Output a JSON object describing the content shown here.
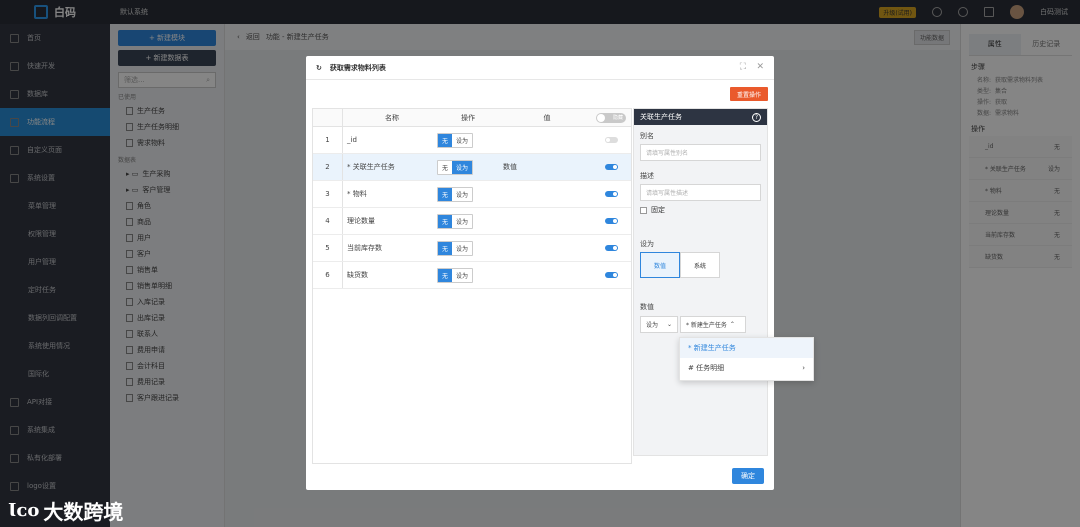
{
  "app": {
    "logo_text": "白码",
    "system_title": "默认系统",
    "upgrade_badge": "升级(试用)",
    "user_name": "白码测试"
  },
  "sidebar": {
    "items": [
      {
        "label": "首页"
      },
      {
        "label": "快速开发"
      },
      {
        "label": "数据库"
      },
      {
        "label": "功能流程",
        "active": true
      },
      {
        "label": "自定义页面"
      },
      {
        "label": "系统设置"
      },
      {
        "label": "菜单管理",
        "sub": true
      },
      {
        "label": "权限管理",
        "sub": true
      },
      {
        "label": "用户管理",
        "sub": true
      },
      {
        "label": "定时任务",
        "sub": true
      },
      {
        "label": "数据列回调配置",
        "sub": true
      },
      {
        "label": "系统使用情况",
        "sub": true
      },
      {
        "label": "国际化",
        "sub": true
      },
      {
        "label": "API对接"
      },
      {
        "label": "系统集成"
      },
      {
        "label": "私有化部署"
      },
      {
        "label": "logo设置"
      }
    ]
  },
  "tree": {
    "new_block": "+ 新建模块",
    "new_table": "+ 新建数据表",
    "search_placeholder": "筛选...",
    "used_label": "已使用",
    "used_items": [
      "生产任务",
      "生产任务明细",
      "需求物料"
    ],
    "all_label": "数据表",
    "folders": [
      "生产采购",
      "客户管理"
    ],
    "items": [
      "角色",
      "商品",
      "用户",
      "客户",
      "销售单",
      "销售单明细",
      "入库记录",
      "出库记录",
      "联系人",
      "费用申请",
      "会计科目",
      "费用记录",
      "客户跟进记录"
    ]
  },
  "breadcrumb": {
    "back": "返回",
    "path": "功能 - 新建生产任务",
    "right_btn": "功能数据"
  },
  "right_panel": {
    "tab_props": "属性",
    "tab_history": "历史记录",
    "steps_label": "步骤",
    "steps": [
      {
        "k": "名称:",
        "v": "获取需求物料列表"
      },
      {
        "k": "类型:",
        "v": "集合"
      },
      {
        "k": "操作:",
        "v": "获取"
      },
      {
        "k": "数据:",
        "v": "需求物料"
      }
    ],
    "ops_label": "操作",
    "rows": [
      {
        "k": "_id",
        "v": "无"
      },
      {
        "k": "* 关联生产任务",
        "v": "设为"
      },
      {
        "k": "* 物料",
        "v": "无"
      },
      {
        "k": "理论数量",
        "v": "无"
      },
      {
        "k": "当前库存数",
        "v": "无"
      },
      {
        "k": "缺货数",
        "v": "无"
      }
    ]
  },
  "dialog": {
    "title": "获取需求物料列表",
    "reset": "重置操作",
    "confirm": "确定",
    "columns": {
      "name": "名称",
      "op": "操作",
      "value": "值"
    },
    "head_toggle": "隐藏",
    "rows": [
      {
        "idx": "1",
        "name": "_id",
        "op_none": "无",
        "op_set": "设为",
        "value": "",
        "on": false
      },
      {
        "idx": "2",
        "name": "* 关联生产任务",
        "op_none": "无",
        "op_set": "设为",
        "value": "数值",
        "on": true
      },
      {
        "idx": "3",
        "name": "* 物料",
        "op_none": "无",
        "op_set": "设为",
        "value": "",
        "on": true
      },
      {
        "idx": "4",
        "name": "理论数量",
        "op_none": "无",
        "op_set": "设为",
        "value": "",
        "on": true
      },
      {
        "idx": "5",
        "name": "当前库存数",
        "op_none": "无",
        "op_set": "设为",
        "value": "",
        "on": true
      },
      {
        "idx": "6",
        "name": "缺货数",
        "op_none": "无",
        "op_set": "设为",
        "value": "",
        "on": true
      }
    ],
    "detail": {
      "header": "关联生产任务",
      "alias_label": "别名",
      "alias_placeholder": "请填写属性别名",
      "desc_label": "描述",
      "desc_placeholder": "请填写属性描述",
      "fixed_label": "固定",
      "setas_label": "设为",
      "setas_value": "数值",
      "setas_system": "系统",
      "num_label": "数值",
      "num_mode": "设为",
      "num_select": "* 新建生产任务"
    },
    "popup": [
      {
        "label": "* 新建生产任务",
        "selected": true
      },
      {
        "label": "# 任务明细",
        "arrow": "›"
      }
    ]
  },
  "watermark": {
    "text": "大数跨境",
    "logo": "Ɩᴄᴏ"
  }
}
